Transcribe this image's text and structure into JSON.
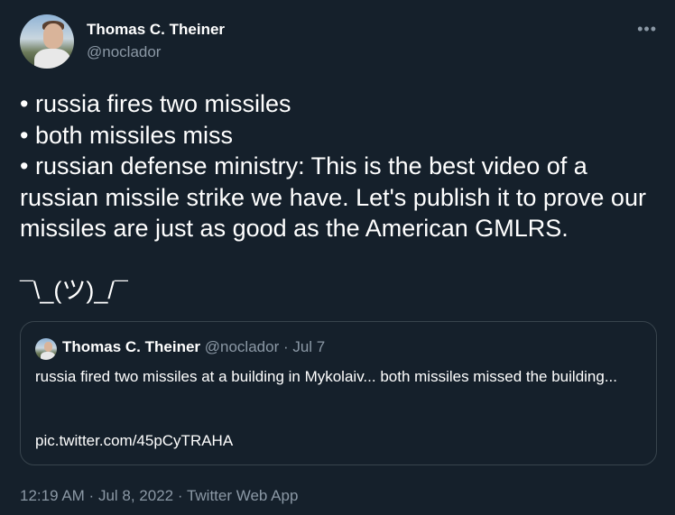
{
  "author": {
    "display_name": "Thomas C. Theiner",
    "handle": "@noclador"
  },
  "more_icon": "more-options-icon",
  "more_glyph": "•••",
  "tweet": {
    "lines": [
      "• russia fires two missiles",
      "• both missiles miss",
      "• russian defense ministry: This is the best video of a russian missile strike we have. Let's publish it to prove our missiles are just as good as the American GMLRS."
    ],
    "shrug": "¯\\_(ツ)_/¯"
  },
  "quoted": {
    "display_name": "Thomas C. Theiner",
    "handle": "@noclador",
    "separator": " · ",
    "date": "Jul 7",
    "text": "russia fired two missiles at a building in Mykolaiv... both missiles missed the building...",
    "link": "pic.twitter.com/45pCyTRAHA"
  },
  "footer": {
    "time": "12:19 AM",
    "date": "Jul 8, 2022",
    "separator": " · ",
    "source": "Twitter Web App"
  },
  "colors": {
    "background": "#15202b",
    "text": "#ffffff",
    "secondary": "#8b98a5",
    "border": "#38444d"
  }
}
